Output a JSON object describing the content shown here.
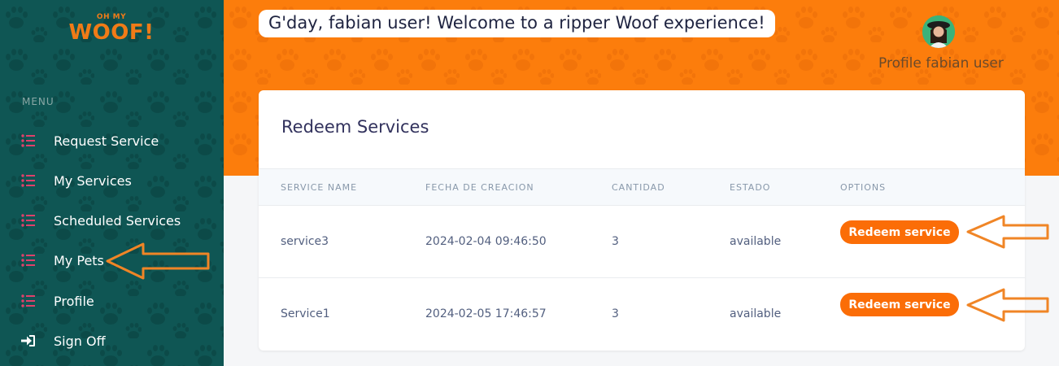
{
  "brand": {
    "logo_top": "OH MY",
    "logo_main": "WOOF!",
    "primary_color": "#fc7d0c",
    "sidebar_color": "#0f5654",
    "accent_color": "#e0406a"
  },
  "sidebar": {
    "menu_title": "MENU",
    "items": [
      {
        "label": "Request Service",
        "icon": "list-icon"
      },
      {
        "label": "My Services",
        "icon": "list-icon"
      },
      {
        "label": "Scheduled Services",
        "icon": "list-icon"
      },
      {
        "label": "My Pets",
        "icon": "list-icon"
      },
      {
        "label": "Profile",
        "icon": "list-icon"
      },
      {
        "label": "Sign Off",
        "icon": "sign-in-icon"
      }
    ]
  },
  "header": {
    "greeting": "G'day, fabian user! Welcome to a ripper Woof experience!",
    "profile_label": "Profile fabian user"
  },
  "card": {
    "title": "Redeem Services",
    "columns": [
      "SERVICE NAME",
      "FECHA DE CREACION",
      "CANTIDAD",
      "ESTADO",
      "OPTIONS"
    ],
    "rows": [
      {
        "name": "service3",
        "date": "2024-02-04 09:46:50",
        "quantity": "3",
        "status": "available",
        "action": "Redeem service"
      },
      {
        "name": "Service1",
        "date": "2024-02-05 17:46:57",
        "quantity": "3",
        "status": "available",
        "action": "Redeem service"
      }
    ]
  }
}
